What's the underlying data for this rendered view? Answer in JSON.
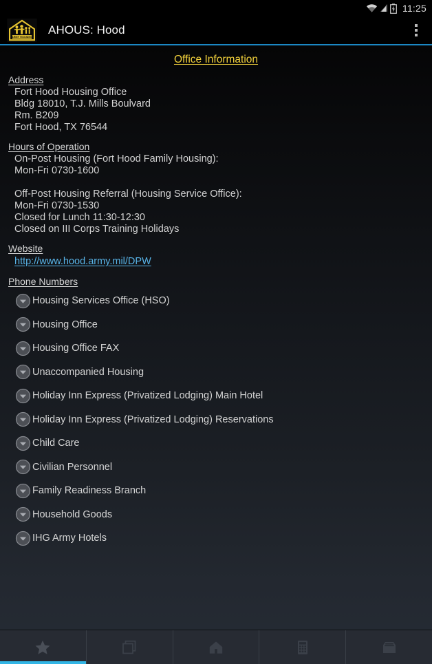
{
  "statusbar": {
    "clock": "11:25",
    "icons": [
      "wifi-icon",
      "cell-signal-icon",
      "battery-charging-icon"
    ]
  },
  "actionbar": {
    "logo_icon": "ahous-house-logo",
    "title": "AHOUS: Hood",
    "overflow_icon": "overflow-menu-icon",
    "accent_color": "#1b87c4"
  },
  "page": {
    "title": "Office Information",
    "title_color": "#f2d13c"
  },
  "sections": {
    "address": {
      "heading": "Address",
      "lines": [
        "Fort Hood Housing Office",
        "Bldg 18010, T.J. Mills Boulvard",
        "Rm. B209",
        "Fort Hood, TX 76544"
      ]
    },
    "hours": {
      "heading": "Hours of Operation",
      "lines": [
        "On-Post Housing (Fort Hood Family Housing):",
        "Mon-Fri 0730-1600",
        "",
        "Off-Post Housing Referral (Housing Service Office):",
        "Mon-Fri 0730-1530",
        "Closed for Lunch 11:30-12:30",
        "Closed on III Corps Training Holidays"
      ]
    },
    "website": {
      "heading": "Website",
      "url_text": "http://www.hood.army.mil/DPW",
      "link_color": "#58b4e8"
    },
    "phone_numbers": {
      "heading": "Phone Numbers",
      "items": [
        {
          "label": "Housing Services Office (HSO)",
          "expander_icon": "chevron-down-circle-icon"
        },
        {
          "label": "Housing Office",
          "expander_icon": "chevron-down-circle-icon"
        },
        {
          "label": "Housing Office FAX",
          "expander_icon": "chevron-down-circle-icon"
        },
        {
          "label": "Unaccompanied Housing",
          "expander_icon": "chevron-down-circle-icon"
        },
        {
          "label": "Holiday Inn Express (Privatized Lodging) Main Hotel",
          "expander_icon": "chevron-down-circle-icon"
        },
        {
          "label": "Holiday Inn Express (Privatized Lodging) Reservations",
          "expander_icon": "chevron-down-circle-icon"
        },
        {
          "label": "Child Care",
          "expander_icon": "chevron-down-circle-icon"
        },
        {
          "label": "Civilian Personnel",
          "expander_icon": "chevron-down-circle-icon"
        },
        {
          "label": "Family Readiness Branch",
          "expander_icon": "chevron-down-circle-icon"
        },
        {
          "label": "Household Goods",
          "expander_icon": "chevron-down-circle-icon"
        },
        {
          "label": "IHG Army Hotels",
          "expander_icon": "chevron-down-circle-icon"
        }
      ]
    }
  },
  "tabbar": {
    "active_index": 0,
    "active_color": "#33b5e5",
    "tabs": [
      {
        "icon": "star-icon"
      },
      {
        "icon": "copy-pages-icon"
      },
      {
        "icon": "house-icon"
      },
      {
        "icon": "calculator-icon"
      },
      {
        "icon": "inbox-tray-icon"
      }
    ]
  }
}
